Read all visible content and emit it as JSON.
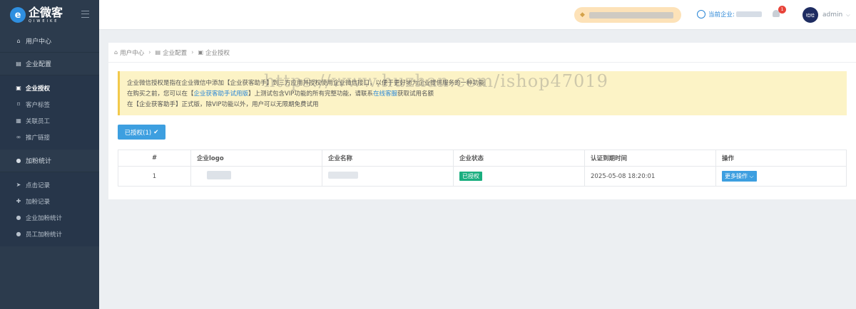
{
  "app": {
    "logo_mark": "e",
    "logo_name": "企微客",
    "logo_sub": "QIWEIKE"
  },
  "sidebar": {
    "items": [
      {
        "label": "用户中心",
        "icon": "home-icon"
      },
      {
        "label": "企业配置",
        "icon": "document-icon"
      },
      {
        "label": "企业授权",
        "icon": "picture-icon",
        "active": true
      },
      {
        "label": "客户标签",
        "icon": "bookmark-icon"
      },
      {
        "label": "关联员工",
        "icon": "qrcode-icon"
      },
      {
        "label": "推广链接",
        "icon": "link-icon"
      },
      {
        "label": "加粉统计",
        "icon": "user-icon"
      },
      {
        "label": "点击记录",
        "icon": "pointer-icon"
      },
      {
        "label": "加粉记录",
        "icon": "user-plus-icon"
      },
      {
        "label": "企业加粉统计",
        "icon": "user-icon"
      },
      {
        "label": "员工加粉统计",
        "icon": "user-icon"
      }
    ]
  },
  "header": {
    "company_label": "当前企业:",
    "badge_count": "1",
    "avatar_text": "哈哈",
    "username": "admin"
  },
  "breadcrumb": {
    "items": [
      "用户中心",
      "企业配置",
      "企业授权"
    ]
  },
  "notice": {
    "line1": "企业微信授权是指在企业微信中添加【企业获客助手】到三方应用并授权使用企业微信接口，以便于更好地为企业提供服务的一种功能",
    "line2_a": "在购买之前，您可以在【",
    "line2_link": "企业获客助手试用版",
    "line2_b": "】上测试包含VIP功能的所有完整功能，请联系",
    "line2_link2": "在线客服",
    "line2_c": "获取试用名额",
    "line3": "在【企业获客助手】正式版，除VIP功能以外，用户可以无限期免费试用"
  },
  "watermark": "https://www.huzhan.com/ishop47019",
  "authorized_button": "已授权(1)",
  "table": {
    "headers": [
      "#",
      "企业logo",
      "企业名称",
      "企业状态",
      "认证到期时间",
      "操作"
    ],
    "rows": [
      {
        "index": "1",
        "status": "已授权",
        "expire": "2025-05-08 18:20:01",
        "action": "更多操作"
      }
    ]
  },
  "colors": {
    "sidebar_bg": "#2c3b4d",
    "accent": "#3d9fe0",
    "success": "#1aae7f",
    "notice_bg": "#fcf3c6"
  }
}
